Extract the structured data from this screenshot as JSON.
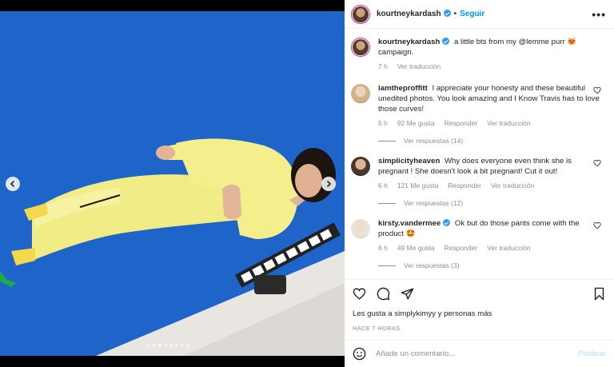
{
  "post": {
    "author": "kourtneykardash",
    "follow_label": "Seguir",
    "separator": "•",
    "more_label": "•••"
  },
  "caption": {
    "user": "kourtneykardash",
    "text": "a little bts from my @lemme purr 😻 campaign.",
    "time": "7 h",
    "translate_label": "Ver traducción"
  },
  "comments": [
    {
      "user": "iamtheproffitt",
      "text": "I appreciate your honesty and these beautiful unedited photos. You look amazing and I Know Travis has to love those curves!",
      "time": "5 h",
      "likes": "92 Me gusta",
      "reply_label": "Responder",
      "translate_label": "Ver traducción",
      "replies_label": "Ver respuestas (14)"
    },
    {
      "user": "simplicityheaven",
      "text": "Why does everyone even think she is pregnant ! She doesn't look a bit pregnant! Cut it out!",
      "time": "6 h",
      "likes": "121 Me gusta",
      "reply_label": "Responder",
      "translate_label": "Ver traducción",
      "replies_label": "Ver respuestas (12)"
    },
    {
      "user": "kirsty.vandermee",
      "text": "Ok but do those pants come with the product 🤩",
      "time": "6 h",
      "likes": "49 Me gusta",
      "reply_label": "Responder",
      "translate_label": "Ver traducción",
      "replies_label": "Ver respuestas (3)"
    }
  ],
  "likes_text": "Les gusta a simplykimyy y personas más",
  "time_ago": "HACE 7 HORAS",
  "add_comment": {
    "placeholder": "Añade un comentario...",
    "publish_label": "Publicar"
  },
  "carousel": {
    "slide_count": 8,
    "active_index": 2
  },
  "colors": {
    "background": "#1e63c8",
    "accent": "#0095f6",
    "outfit": "#f3ee8a"
  },
  "icons": [
    "chevron-left-icon",
    "chevron-right-icon",
    "verified-badge-icon",
    "more-icon",
    "heart-icon",
    "comment-icon",
    "share-icon",
    "bookmark-icon",
    "emoji-icon"
  ]
}
